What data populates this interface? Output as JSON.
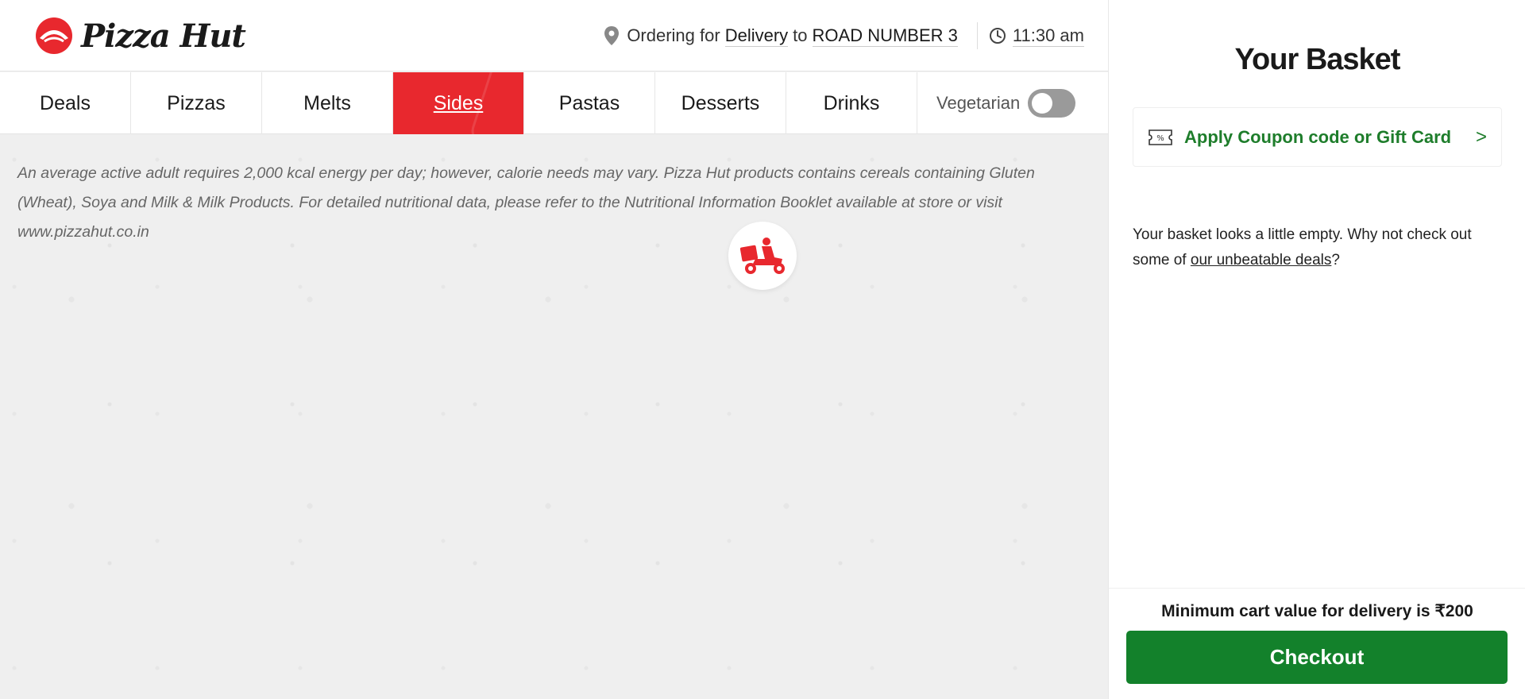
{
  "brand": {
    "name": "Pizza Hut",
    "primary_color": "#e8282e",
    "accent_green": "#13812b"
  },
  "header": {
    "ordering_prefix": "Ordering for",
    "order_mode": "Delivery",
    "to_text": "to",
    "location": "ROAD NUMBER 3",
    "time": "11:30 am"
  },
  "nav": {
    "items": [
      {
        "label": "Deals"
      },
      {
        "label": "Pizzas"
      },
      {
        "label": "Melts"
      },
      {
        "label": "Sides",
        "active": true
      },
      {
        "label": "Pastas"
      },
      {
        "label": "Desserts"
      },
      {
        "label": "Drinks"
      }
    ],
    "veg_label": "Vegetarian",
    "veg_toggle": "off"
  },
  "disclaimer": "An average active adult requires 2,000 kcal energy per day; however, calorie needs may vary. Pizza Hut products contains cereals containing Gluten (Wheat), Soya and Milk & Milk Products. For detailed nutritional data, please refer to the Nutritional Information Booklet available at store or visit www.pizzahut.co.in",
  "basket": {
    "title": "Your Basket",
    "coupon_label": "Apply Coupon code or Gift Card",
    "coupon_arrow": ">",
    "empty_prefix": "Your basket looks a little empty. Why not check out some of ",
    "empty_link": "our unbeatable deals",
    "empty_suffix": "?",
    "min_cart": "Minimum cart value for delivery is ₹200",
    "checkout_label": "Checkout"
  },
  "icons": {
    "logo": "pizza-hut-logo-icon",
    "pin": "location-pin-icon",
    "clock": "clock-icon",
    "scooter": "delivery-scooter-icon",
    "coupon": "coupon-ticket-icon"
  }
}
